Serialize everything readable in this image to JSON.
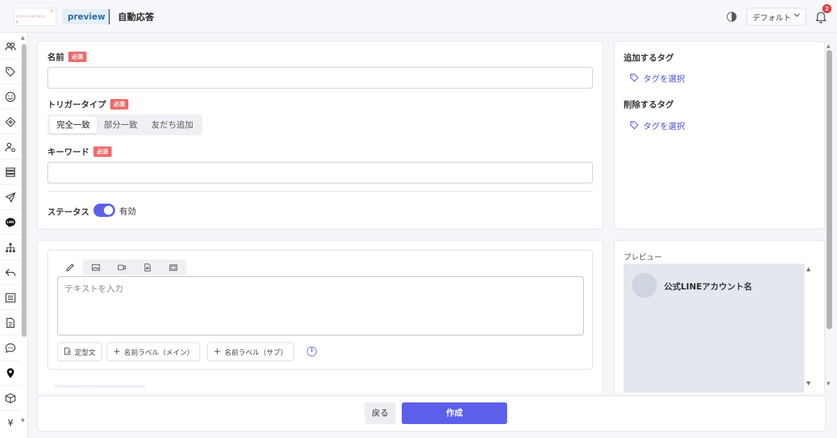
{
  "header": {
    "logo_text": "ASSIGN LINE MEGA",
    "env_badge": "preview",
    "title": "自動応答",
    "workspace_select": "デフォルト",
    "notification_count": "2"
  },
  "sidebar": {
    "items": [
      {
        "icon": "users-icon"
      },
      {
        "icon": "tags-icon"
      },
      {
        "icon": "smile-icon"
      },
      {
        "icon": "tag-diamond-icon"
      },
      {
        "icon": "user-gear-icon"
      },
      {
        "icon": "list-icon"
      },
      {
        "icon": "send-icon"
      },
      {
        "icon": "line-icon",
        "label": "LINE"
      },
      {
        "icon": "sitemap-icon"
      },
      {
        "icon": "reply-icon"
      },
      {
        "icon": "text-list-icon"
      },
      {
        "icon": "document-icon"
      },
      {
        "icon": "chat-icon"
      },
      {
        "icon": "location-pin-icon"
      },
      {
        "icon": "box-icon"
      },
      {
        "icon": "yen-icon",
        "label": "¥"
      }
    ]
  },
  "form": {
    "name_label": "名前",
    "required_badge": "必須",
    "trigger_label": "トリガータイプ",
    "trigger_options": [
      "完全一致",
      "部分一致",
      "友だち追加"
    ],
    "trigger_selected": "完全一致",
    "keyword_label": "キーワード",
    "status_label": "ステータス",
    "status_value": "有効"
  },
  "tags": {
    "add_label": "追加するタグ",
    "add_select": "タグを選択",
    "remove_label": "削除するタグ",
    "remove_select": "タグを選択"
  },
  "editor": {
    "placeholder": "テキストを入力",
    "template_button": "定型文",
    "name_label_main": "名前ラベル（メイン）",
    "name_label_sub": "名前ラベル（サブ）"
  },
  "preview": {
    "title": "プレビュー",
    "account_name": "公式LINEアカウント名"
  },
  "footer": {
    "back_label": "戻る",
    "create_label": "作成"
  },
  "colors": {
    "accent": "#5b5fea",
    "required": "#f06b6b",
    "badge_bg": "#e4eef8",
    "badge_text": "#2d6da8"
  }
}
